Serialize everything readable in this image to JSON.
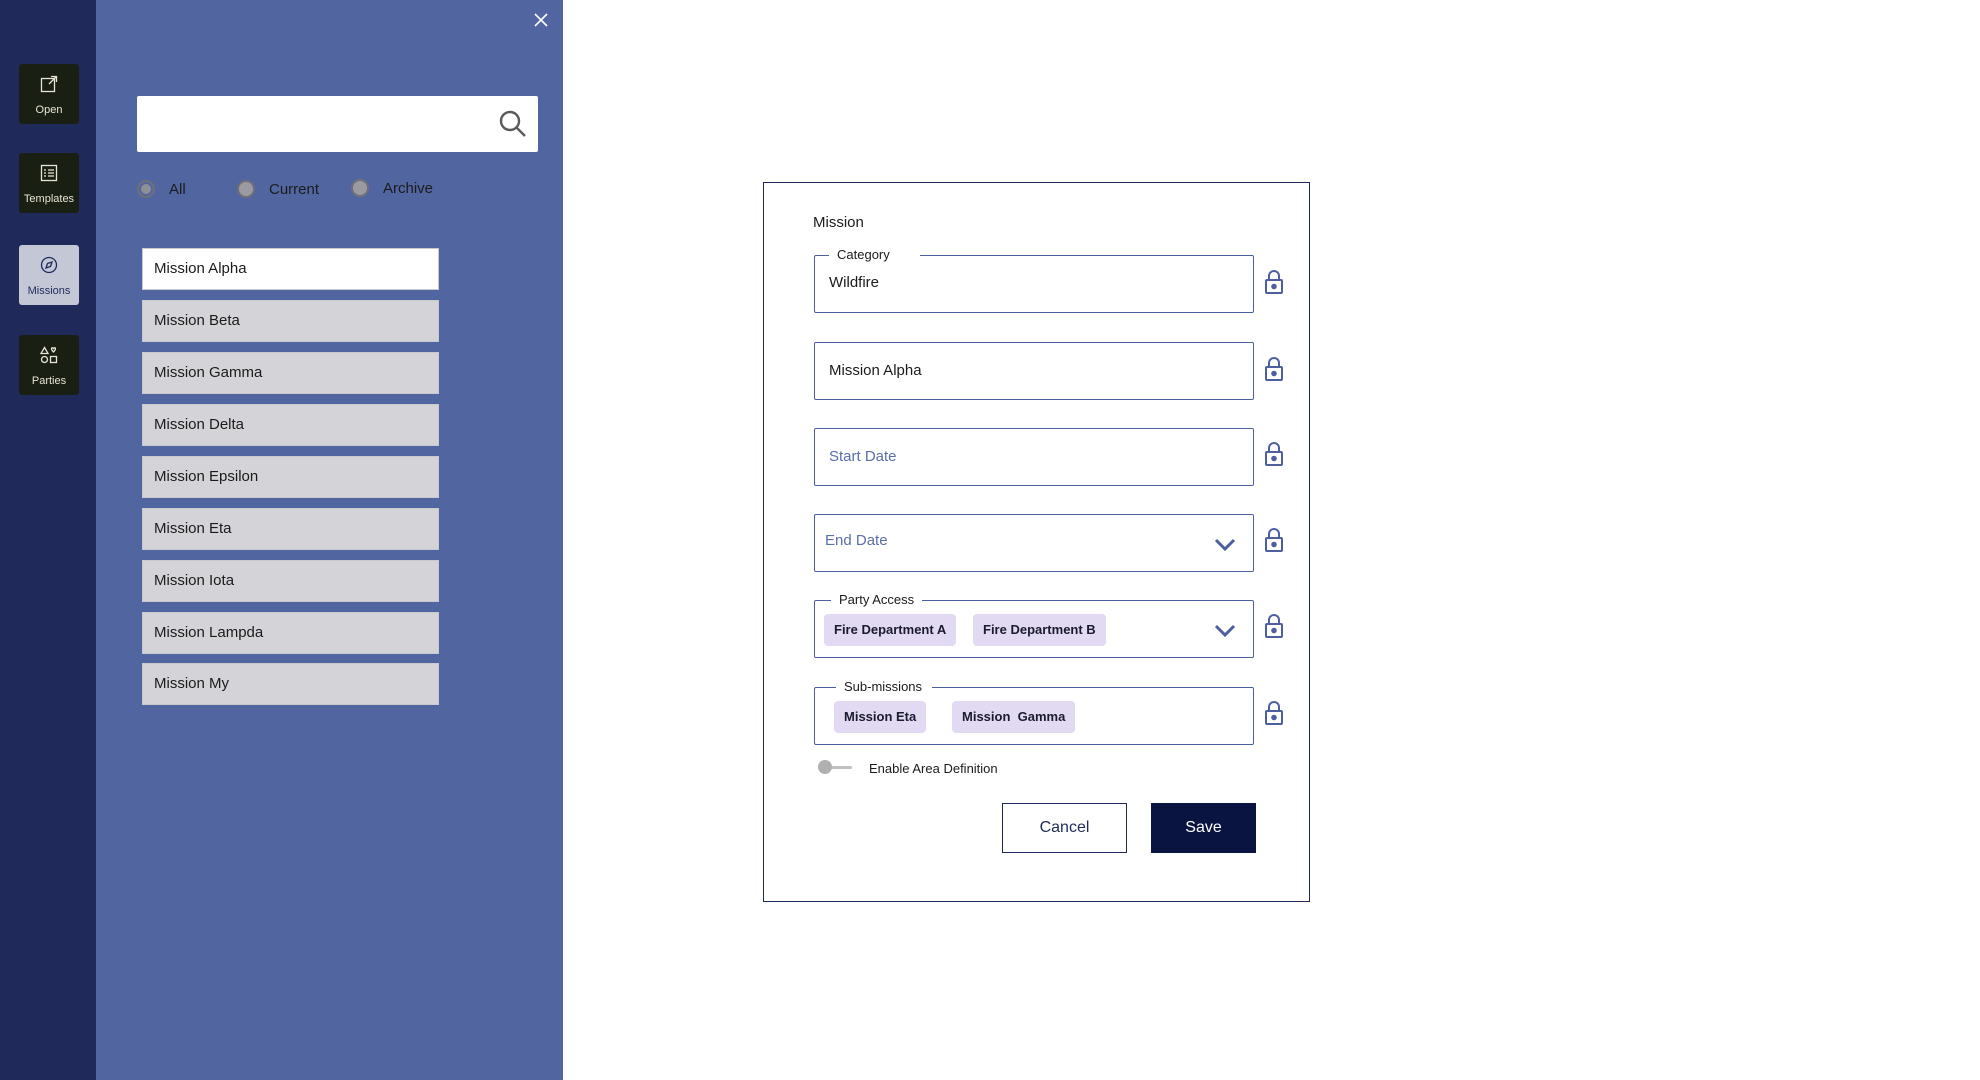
{
  "rail": {
    "items": [
      {
        "label": "Open",
        "icon": "external-link-icon"
      },
      {
        "label": "Templates",
        "icon": "template-icon"
      },
      {
        "label": "Missions",
        "icon": "compass-icon"
      },
      {
        "label": "Parties",
        "icon": "shapes-icon"
      }
    ],
    "active": "Missions"
  },
  "panel": {
    "search": {
      "value": "",
      "placeholder": ""
    },
    "filters": [
      {
        "label": "All",
        "checked": true
      },
      {
        "label": "Current",
        "checked": false
      },
      {
        "label": "Archive",
        "checked": false
      }
    ],
    "missions": [
      "Mission Alpha",
      "Mission Beta",
      "Mission Gamma",
      "Mission Delta",
      "Mission Epsilon",
      "Mission Eta",
      "Mission Iota",
      "Mission Lampda",
      "Mission My"
    ],
    "selected_mission": "Mission Alpha"
  },
  "form": {
    "title": "Mission",
    "category": {
      "legend": "Category",
      "value": "Wildfire"
    },
    "name": {
      "value": "Mission Alpha"
    },
    "start_date": {
      "placeholder": "Start Date"
    },
    "end_date": {
      "placeholder": "End Date"
    },
    "party_access": {
      "legend": "Party Access",
      "chips": [
        "Fire Department A",
        "Fire Department B"
      ]
    },
    "sub_missions": {
      "legend": "Sub-missions",
      "chips": [
        "Mission Eta",
        "Mission  Gamma"
      ]
    },
    "area_toggle": {
      "label": "Enable Area Definition",
      "on": false
    },
    "cancel_label": "Cancel",
    "save_label": "Save"
  },
  "colors": {
    "rail_bg": "#1f2a5a",
    "panel_bg": "#5166a0",
    "chip_bg": "#e2d9f2",
    "save_bg": "#0a1440",
    "field_border": "#4e5fa0"
  }
}
